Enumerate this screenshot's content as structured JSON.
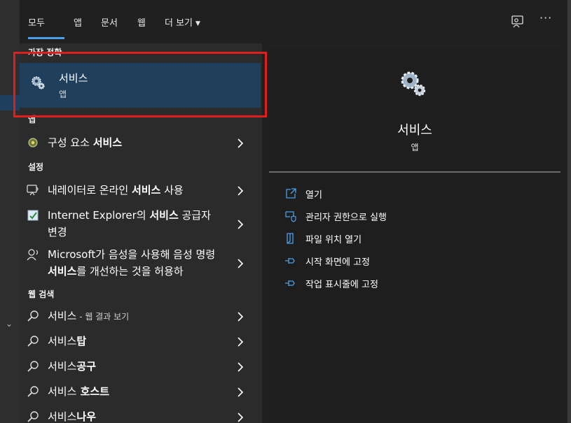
{
  "tabs": [
    {
      "label": "모두"
    },
    {
      "label": "앱"
    },
    {
      "label": "문서"
    },
    {
      "label": "웹"
    },
    {
      "label": "더 보기"
    }
  ],
  "ellipsis": "···",
  "best_match": {
    "section": "가장 정확",
    "title": "서비스",
    "subtitle": "앱"
  },
  "sections": {
    "apps": "앱",
    "settings": "설정",
    "web": "웹 검색"
  },
  "app_row": {
    "pre": "구성 요소 ",
    "bold": "서비스",
    "post": ""
  },
  "settings_rows": [
    {
      "pre": "내레이터로 온라인 ",
      "bold": "서비스",
      "post": " 사용"
    },
    {
      "pre": "Internet Explorer의 ",
      "bold": "서비스",
      "post": " 공급자 변경"
    },
    {
      "pre": "Microsoft가 음성을 사용해 음성 명령 ",
      "bold": "서비스",
      "post": "를 개선하는 것을 허용하"
    }
  ],
  "web_rows": [
    {
      "pre": "서비스",
      "bold": "",
      "post": "",
      "small": " - 웹 결과 보기"
    },
    {
      "pre": "서비스",
      "bold": "탑",
      "post": "",
      "small": ""
    },
    {
      "pre": "서비스",
      "bold": "공구",
      "post": "",
      "small": ""
    },
    {
      "pre": "서비스",
      "bold": " 호스트",
      "post": "",
      "small": ""
    },
    {
      "pre": "서비스",
      "bold": "나우",
      "post": "",
      "small": ""
    }
  ],
  "preview": {
    "title": "서비스",
    "subtitle": "앱",
    "actions": [
      {
        "label": "열기",
        "icon": "open-icon"
      },
      {
        "label": "관리자 권한으로 실행",
        "icon": "shield-icon"
      },
      {
        "label": "파일 위치 열기",
        "icon": "file-icon"
      },
      {
        "label": "시작 화면에 고정",
        "icon": "pin-icon"
      },
      {
        "label": "작업 표시줄에 고정",
        "icon": "pin-icon"
      }
    ]
  },
  "colors": {
    "accent": "#4a9fe8",
    "selection": "#1f3f5c",
    "highlight_box": "#e01e1e"
  }
}
